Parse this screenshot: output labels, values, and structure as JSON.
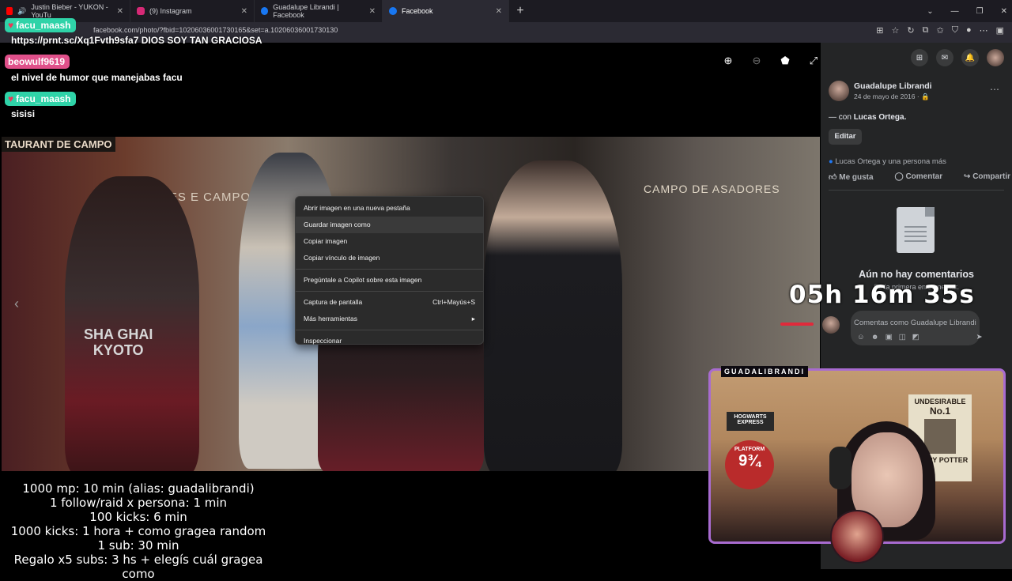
{
  "tabs": [
    {
      "label": "Justin Bieber - YUKON - YouTu",
      "color": "#ff0000",
      "icon": "youtube-icon"
    },
    {
      "label": "(9) Instagram",
      "color": "#d62976",
      "icon": "instagram-icon"
    },
    {
      "label": "Guadalupe Librandi | Facebook",
      "color": "#1877f2",
      "icon": "facebook-icon"
    },
    {
      "label": "Facebook",
      "color": "#1877f2",
      "icon": "facebook-icon"
    }
  ],
  "address": {
    "url": "facebook.com/photo/?fbid=10206036001730165&set=a.10206036001730130"
  },
  "photo": {
    "sign1": "TAURANT DE CAMPO",
    "sign2": "RES   E CAMPO",
    "sign3": "CAMPO DE ASADORES",
    "shirt": "SHA GHAI\nKYOTO"
  },
  "context_menu": {
    "items": [
      "Abrir imagen en una nueva pestaña",
      "Guardar imagen como",
      "Copiar imagen",
      "Copiar vínculo de imagen",
      "Pregúntale a Copilot sobre esta imagen",
      "Captura de pantalla",
      "Más herramientas",
      "Inspeccionar"
    ],
    "shortcut": "Ctrl+Mayús+S"
  },
  "chat": {
    "messages": [
      {
        "user": "facu_maash",
        "text": "https://prnt.sc/Xq1Fvth9sfa7 DIOS SOY TAN GRACIOSA",
        "color": "#2fd3a8"
      },
      {
        "user": "beowulf9619",
        "text": "el nivel de humor que manejabas facu",
        "color": "#e0508a"
      },
      {
        "user": "facu_maash",
        "text": "sisisi",
        "color": "#2fd3a8"
      }
    ]
  },
  "post": {
    "author": "Guadalupe Librandi",
    "date": "24 de mayo de 2016 · ",
    "with_text": "— con ",
    "with_name": "Lucas Ortega.",
    "edit": "Editar",
    "likes": "Lucas Ortega y una persona más",
    "like": "Me gusta",
    "comment": "Comentar",
    "share": "Compartir",
    "no_comments": "Aún no hay comentarios",
    "be_first": "Sé la primera en comentar.",
    "comment_placeholder": "Comentas como Guadalupe Librandi"
  },
  "stream": {
    "timer": "05h 16m 35s",
    "cam_label": "GUADALIBRANDI",
    "goals": [
      "1000 mp: 10 min (alias: guadalibrandi)",
      "1 follow/raid x persona: 1 min",
      "100 kicks: 6 min",
      "1000 kicks: 1 hora + como gragea random",
      "1 sub: 30 min",
      "Regalo x5 subs: 3 hs + elegís cuál gragea como"
    ],
    "poster_title": "UNDESIRABLE",
    "poster_no": "No.1",
    "poster_name": "HARRY POTTER",
    "platform": "PLATFORM",
    "platform_no": "9¾",
    "hogwarts": "HOGWARTS EXPRESS"
  }
}
